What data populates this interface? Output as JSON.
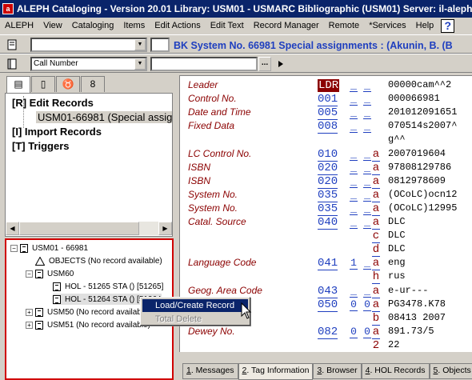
{
  "window": {
    "title": "ALEPH Cataloging - Version 20.01  Library:  USM01 - USMARC Bibliographic (USM01)  Server: il-aleph0"
  },
  "menu": [
    "ALEPH",
    "View",
    "Cataloging",
    "Items",
    "Edit Actions",
    "Edit Text",
    "Record Manager",
    "Remote",
    "*Services",
    "Help"
  ],
  "help_icon": "?",
  "toolbar": {
    "search_value": "",
    "record_header": "BK System No. 66981 Special assignments : (Akunin, B. (B",
    "index_select": "Call Number",
    "index_value": "",
    "dots_label": "..."
  },
  "left_tabs": [
    "doc-icon",
    "book-icon",
    "flask-icon",
    "binoculars-icon"
  ],
  "tree": {
    "edit_records": "[R] Edit Records",
    "edit_child": "USM01-66981 (Special assignm",
    "import_records": "[I] Import Records",
    "triggers": "[T] Triggers"
  },
  "nav": {
    "root": "USM01 - 66981",
    "objects": "OBJECTS (No record available)",
    "usm60": "USM60",
    "hol1": "HOL - 51265 STA () [51265]",
    "hol2": "HOL - 51264 STA () [51264",
    "usm50": "USM50 (No record available)",
    "usm51": "USM51 (No record available)"
  },
  "marc_fields": [
    {
      "label": "Leader",
      "tag": "LDR",
      "i1": "_",
      "i2": "_",
      "sub": "",
      "value": "00000cam^^2"
    },
    {
      "label": "Control No.",
      "tag": "001",
      "i1": "_",
      "i2": "_",
      "sub": "",
      "value": "000066981"
    },
    {
      "label": "Date and Time",
      "tag": "005",
      "i1": "_",
      "i2": "_",
      "sub": "",
      "value": "201012091651"
    },
    {
      "label": "Fixed Data",
      "tag": "008",
      "i1": "_",
      "i2": "_",
      "sub": "",
      "value": "070514s2007^"
    },
    {
      "label": "",
      "tag": "",
      "i1": "",
      "i2": "",
      "sub": "",
      "value": "g^^"
    },
    {
      "label": "LC Control No.",
      "tag": "010",
      "i1": "_",
      "i2": "_",
      "sub": "a",
      "value": "2007019604"
    },
    {
      "label": "ISBN",
      "tag": "020",
      "i1": "_",
      "i2": "_",
      "sub": "a",
      "value": "97808129786"
    },
    {
      "label": "ISBN",
      "tag": "020",
      "i1": "_",
      "i2": "_",
      "sub": "a",
      "value": "0812978609"
    },
    {
      "label": "System No.",
      "tag": "035",
      "i1": "_",
      "i2": "_",
      "sub": "a",
      "value": "(OCoLC)ocn12"
    },
    {
      "label": "System No.",
      "tag": "035",
      "i1": "_",
      "i2": "_",
      "sub": "a",
      "value": "(OCoLC)12995"
    },
    {
      "label": "Catal. Source",
      "tag": "040",
      "i1": "_",
      "i2": "_",
      "sub": "a",
      "value": "DLC"
    },
    {
      "label": "",
      "tag": "",
      "i1": "",
      "i2": "",
      "sub": "c",
      "value": "DLC"
    },
    {
      "label": "",
      "tag": "",
      "i1": "",
      "i2": "",
      "sub": "d",
      "value": "DLC"
    },
    {
      "label": "Language Code",
      "tag": "041",
      "i1": "1",
      "i2": "_",
      "sub": "a",
      "value": "eng"
    },
    {
      "label": "",
      "tag": "",
      "i1": "",
      "i2": "",
      "sub": "h",
      "value": "rus"
    },
    {
      "label": "Geog. Area Code",
      "tag": "043",
      "i1": "_",
      "i2": "_",
      "sub": "a",
      "value": "e-ur---"
    },
    {
      "label": "",
      "tag": "050",
      "i1": "0",
      "i2": "0",
      "sub": "a",
      "value": "PG3478.K78"
    },
    {
      "label": "",
      "tag": "",
      "i1": "",
      "i2": "",
      "sub": "b",
      "value": "08413 2007"
    },
    {
      "label": "Dewey No.",
      "tag": "082",
      "i1": "0",
      "i2": "0",
      "sub": "a",
      "value": "891.73/5"
    },
    {
      "label": "",
      "tag": "",
      "i1": "",
      "i2": "",
      "sub": "2",
      "value": "22"
    }
  ],
  "context_menu": {
    "load": "Load/Create Record",
    "delete": "Total Delete"
  },
  "bottom_tabs": [
    {
      "num": "1",
      "label": ". Messages"
    },
    {
      "num": "2",
      "label": ". Tag Information"
    },
    {
      "num": "3",
      "label": ". Browser"
    },
    {
      "num": "4",
      "label": ". HOL Records"
    },
    {
      "num": "5",
      "label": ". Objects"
    }
  ]
}
